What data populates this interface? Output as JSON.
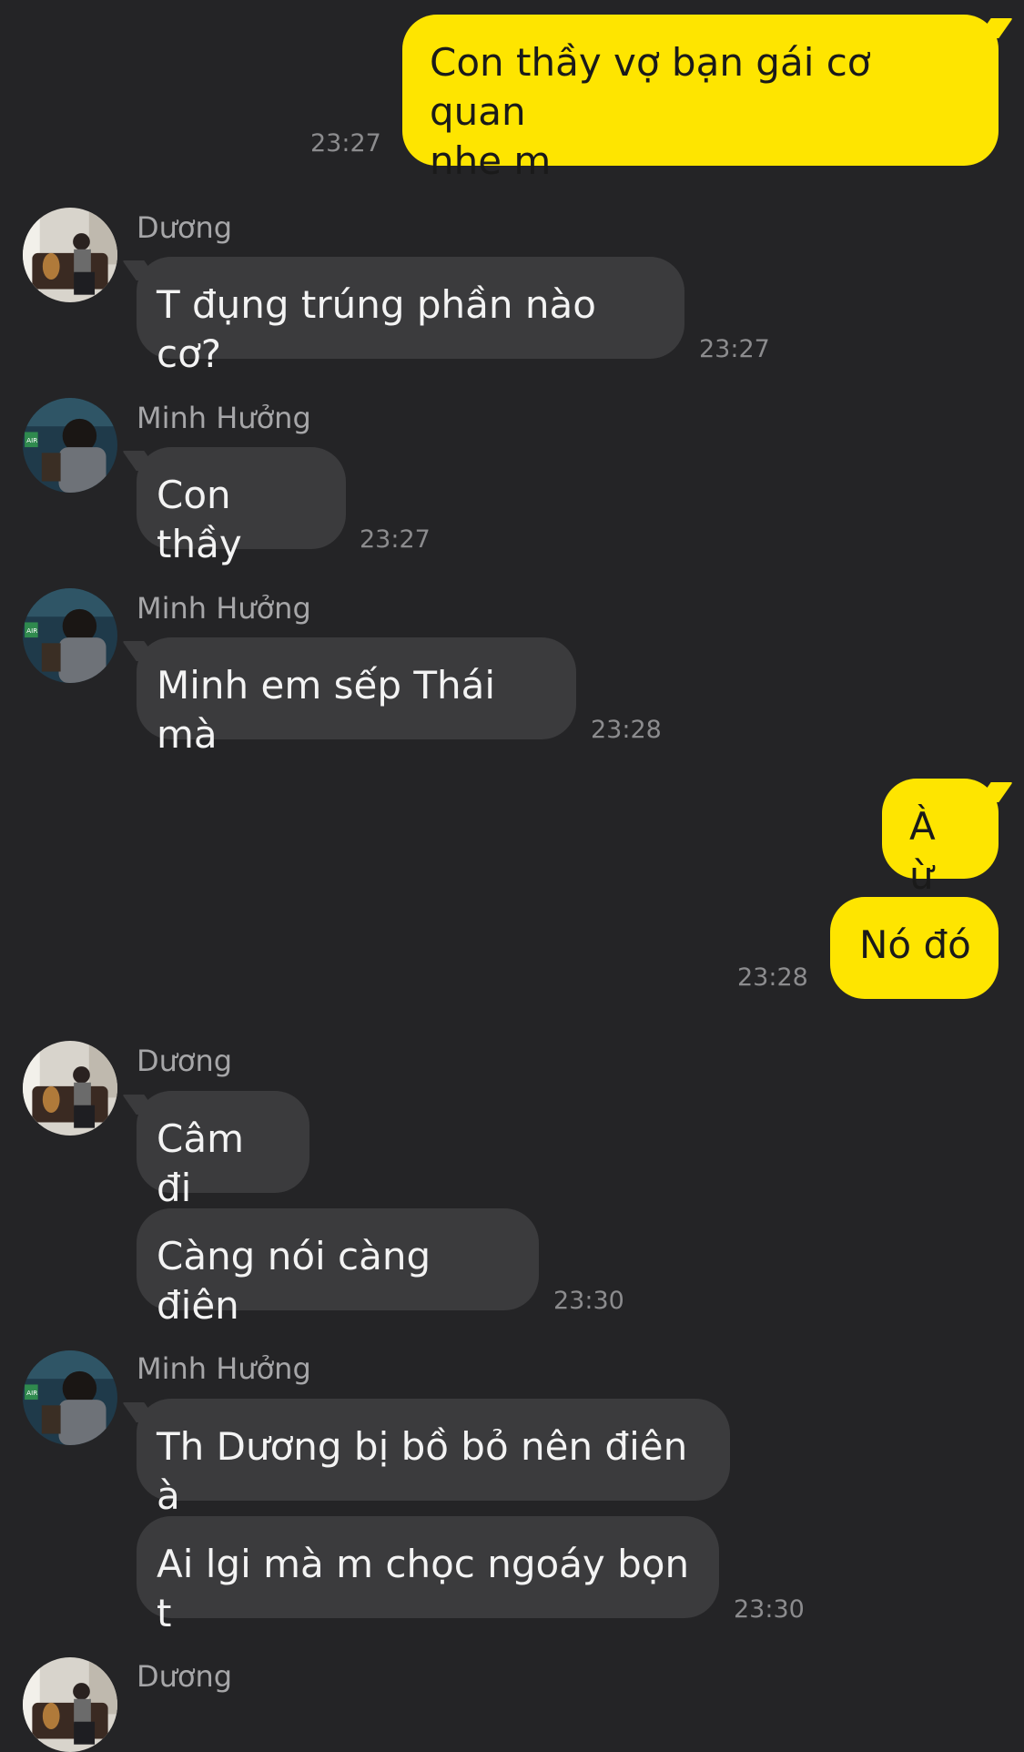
{
  "messages": [
    {
      "id": "m1",
      "direction": "out",
      "text": "Con thầy vợ bạn gái cơ quan\nnhe m",
      "time": "23:27"
    },
    {
      "id": "m2",
      "direction": "in",
      "sender": "Dương",
      "text": "T đụng trúng phần nào cơ?",
      "time": "23:27"
    },
    {
      "id": "m3",
      "direction": "in",
      "sender": "Minh Hưởng",
      "text": "Con thầy",
      "time": "23:27"
    },
    {
      "id": "m4",
      "direction": "in",
      "sender": "Minh Hưởng",
      "text": "Minh em sếp Thái mà",
      "time": "23:28"
    },
    {
      "id": "m5",
      "direction": "out",
      "text": "À ừ"
    },
    {
      "id": "m6",
      "direction": "out",
      "text": "Nó đó",
      "time": "23:28"
    },
    {
      "id": "m7",
      "direction": "in",
      "sender": "Dương",
      "text": "Câm đi"
    },
    {
      "id": "m8",
      "direction": "in",
      "text": "Càng nói càng điên",
      "time": "23:30"
    },
    {
      "id": "m9",
      "direction": "in",
      "sender": "Minh Hưởng",
      "text": "Th Dương bị bồ bỏ nên điên à"
    },
    {
      "id": "m10",
      "direction": "in",
      "text": "Ai lgi mà m chọc ngoáy bọn t",
      "time": "23:30"
    },
    {
      "id": "m11",
      "direction": "in",
      "sender": "Dương"
    }
  ],
  "colors": {
    "background": "#242426",
    "incoming_bubble": "#3b3b3d",
    "outgoing_bubble": "#fee500"
  },
  "icons": {
    "avatar_duong": "avatar-duong-icon",
    "avatar_minh_huong": "avatar-minh-huong-icon"
  }
}
